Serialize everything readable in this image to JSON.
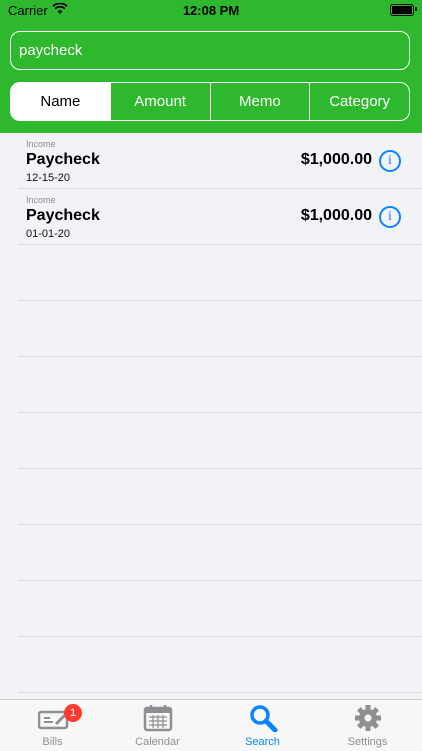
{
  "status": {
    "carrier": "Carrier",
    "time": "12:08 PM"
  },
  "search": {
    "value": "paycheck"
  },
  "segments": [
    {
      "label": "Name",
      "active": true
    },
    {
      "label": "Amount",
      "active": false
    },
    {
      "label": "Memo",
      "active": false
    },
    {
      "label": "Category",
      "active": false
    }
  ],
  "results": [
    {
      "category": "Income",
      "name": "Paycheck",
      "date": "12-15-20",
      "amount": "$1,000.00"
    },
    {
      "category": "Income",
      "name": "Paycheck",
      "date": "01-01-20",
      "amount": "$1,000.00"
    }
  ],
  "tabs": [
    {
      "label": "Bills",
      "icon": "bills-check-icon",
      "badge": "1",
      "active": false
    },
    {
      "label": "Calendar",
      "icon": "calendar-icon",
      "active": false
    },
    {
      "label": "Search",
      "icon": "search-icon",
      "active": true
    },
    {
      "label": "Settings",
      "icon": "gear-icon",
      "active": false
    }
  ],
  "colors": {
    "header": "#2eb82e",
    "accent": "#0a84ff",
    "badge": "#ff3b30"
  }
}
